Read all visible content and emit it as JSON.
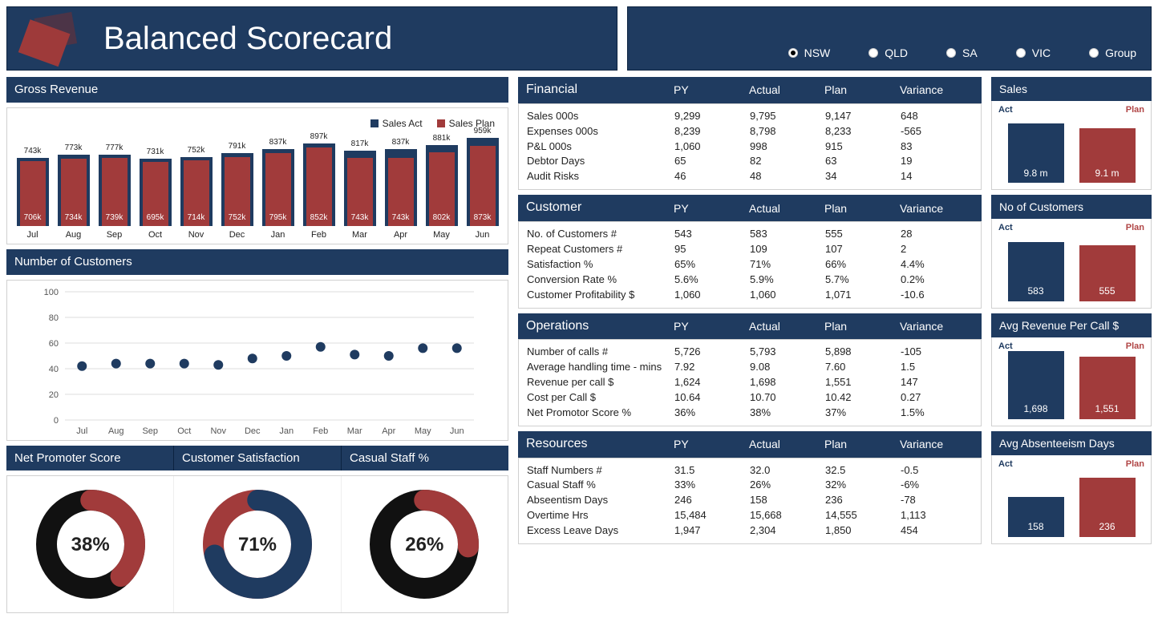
{
  "title": "Balanced Scorecard",
  "regions": [
    "NSW",
    "QLD",
    "SA",
    "VIC",
    "Group"
  ],
  "selected_region": "NSW",
  "gross_revenue": {
    "title": "Gross Revenue",
    "legend": {
      "act": "Sales Act",
      "plan": "Sales Plan"
    }
  },
  "customers_chart_title": "Number of Customers",
  "donut_titles": [
    "Net Promoter Score",
    "Customer Satisfaction",
    "Casual Staff %"
  ],
  "donut_pcts": [
    "38%",
    "71%",
    "26%"
  ],
  "sections": {
    "financial": {
      "title": "Financial",
      "headers": [
        "PY",
        "Actual",
        "Plan",
        "Variance"
      ],
      "rows": [
        [
          "Sales 000s",
          "9,299",
          "9,795",
          "9,147",
          "648"
        ],
        [
          "Expenses 000s",
          "8,239",
          "8,798",
          "8,233",
          "-565"
        ],
        [
          "P&L 000s",
          "1,060",
          "998",
          "915",
          "83"
        ],
        [
          "Debtor Days",
          "65",
          "82",
          "63",
          "19"
        ],
        [
          "Audit Risks",
          "46",
          "48",
          "34",
          "14"
        ]
      ],
      "mini_title": "Sales",
      "mini_act": "9.8 m",
      "mini_plan": "9.1 m"
    },
    "customer": {
      "title": "Customer",
      "headers": [
        "PY",
        "Actual",
        "Plan",
        "Variance"
      ],
      "rows": [
        [
          "No. of Customers #",
          "543",
          "583",
          "555",
          "28"
        ],
        [
          "Repeat Customers #",
          "95",
          "109",
          "107",
          "2"
        ],
        [
          "Satisfaction %",
          "65%",
          "71%",
          "66%",
          "4.4%"
        ],
        [
          "Conversion Rate %",
          "5.6%",
          "5.9%",
          "5.7%",
          "0.2%"
        ],
        [
          "Customer Profitability $",
          "1,060",
          "1,060",
          "1,071",
          "-10.6"
        ]
      ],
      "mini_title": "No of Customers",
      "mini_act": "583",
      "mini_plan": "555"
    },
    "operations": {
      "title": "Operations",
      "headers": [
        "PY",
        "Actual",
        "Plan",
        "Variance"
      ],
      "rows": [
        [
          "Number of calls #",
          "5,726",
          "5,793",
          "5,898",
          "-105"
        ],
        [
          "Average handling time - mins",
          "7.92",
          "9.08",
          "7.60",
          "1.5"
        ],
        [
          "Revenue per call $",
          "1,624",
          "1,698",
          "1,551",
          "147"
        ],
        [
          "Cost per Call $",
          "10.64",
          "10.70",
          "10.42",
          "0.27"
        ],
        [
          "Net Promotor Score %",
          "36%",
          "38%",
          "37%",
          "1.5%"
        ]
      ],
      "mini_title": "Avg Revenue Per Call $",
      "mini_act": "1,698",
      "mini_plan": "1,551"
    },
    "resources": {
      "title": "Resources",
      "headers": [
        "PY",
        "Actual",
        "Plan",
        "Variance"
      ],
      "rows": [
        [
          "Staff Numbers #",
          "31.5",
          "32.0",
          "32.5",
          "-0.5"
        ],
        [
          "Casual Staff %",
          "33%",
          "26%",
          "32%",
          "-6%"
        ],
        [
          "Abseentism Days",
          "246",
          "158",
          "236",
          "-78"
        ],
        [
          "Overtime Hrs",
          "15,484",
          "15,668",
          "14,555",
          "1,113"
        ],
        [
          "Excess Leave Days",
          "1,947",
          "2,304",
          "1,850",
          "454"
        ]
      ],
      "mini_title": "Avg Absenteeism Days",
      "mini_act": "158",
      "mini_plan": "236"
    }
  },
  "mini_labels": {
    "act": "Act",
    "plan": "Plan"
  },
  "chart_data": [
    {
      "type": "bar",
      "title": "Gross Revenue",
      "categories": [
        "Jul",
        "Aug",
        "Sep",
        "Oct",
        "Nov",
        "Dec",
        "Jan",
        "Feb",
        "Mar",
        "Apr",
        "May",
        "Jun"
      ],
      "series": [
        {
          "name": "Sales Act",
          "values": [
            743,
            773,
            777,
            731,
            752,
            791,
            837,
            897,
            817,
            837,
            881,
            959
          ],
          "value_labels": [
            "743k",
            "773k",
            "777k",
            "731k",
            "752k",
            "791k",
            "837k",
            "897k",
            "817k",
            "837k",
            "881k",
            "959k"
          ]
        },
        {
          "name": "Sales Plan",
          "values": [
            706,
            734,
            739,
            695,
            714,
            752,
            795,
            852,
            743,
            743,
            802,
            873
          ],
          "value_labels": [
            "706k",
            "734k",
            "739k",
            "695k",
            "714k",
            "752k",
            "795k",
            "852k",
            "743k",
            "743k",
            "802k",
            "873k"
          ]
        }
      ],
      "ylim": [
        0,
        1000
      ]
    },
    {
      "type": "scatter",
      "title": "Number of Customers",
      "categories": [
        "Jul",
        "Aug",
        "Sep",
        "Oct",
        "Nov",
        "Dec",
        "Jan",
        "Feb",
        "Mar",
        "Apr",
        "May",
        "Jun"
      ],
      "values": [
        42,
        44,
        44,
        44,
        43,
        48,
        50,
        57,
        51,
        50,
        56,
        56
      ],
      "ylim": [
        0,
        100
      ],
      "yticks": [
        0,
        20,
        40,
        60,
        80,
        100
      ]
    },
    {
      "type": "pie",
      "title": "Net Promoter Score",
      "values": [
        38,
        62
      ]
    },
    {
      "type": "pie",
      "title": "Customer Satisfaction",
      "values": [
        71,
        29
      ]
    },
    {
      "type": "pie",
      "title": "Casual Staff %",
      "values": [
        26,
        74
      ]
    },
    {
      "type": "bar",
      "title": "Sales",
      "categories": [
        "Act",
        "Plan"
      ],
      "values": [
        9.8,
        9.1
      ]
    },
    {
      "type": "bar",
      "title": "No of Customers",
      "categories": [
        "Act",
        "Plan"
      ],
      "values": [
        583,
        555
      ]
    },
    {
      "type": "bar",
      "title": "Avg Revenue Per Call $",
      "categories": [
        "Act",
        "Plan"
      ],
      "values": [
        1698,
        1551
      ]
    },
    {
      "type": "bar",
      "title": "Avg Absenteeism Days",
      "categories": [
        "Act",
        "Plan"
      ],
      "values": [
        158,
        236
      ]
    }
  ]
}
